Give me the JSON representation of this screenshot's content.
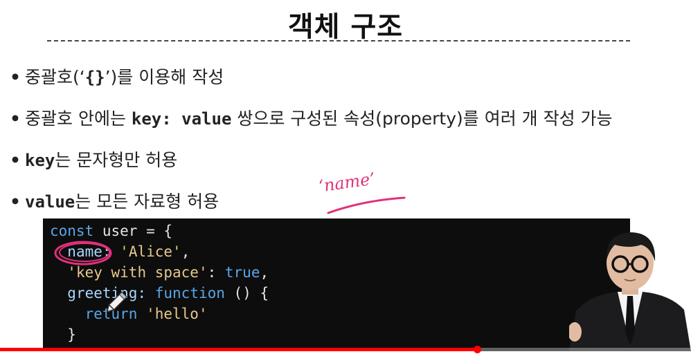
{
  "slide": {
    "title": "객체 구조",
    "bullets": [
      {
        "pre": "중괄호(‘",
        "code": "{}",
        "post": "’)를 이용해 작성"
      },
      {
        "pre": "중괄호 안에는 ",
        "code": "key: value",
        "post": " 쌍으로 구성된 속성(property)를 여러 개 작성 가능"
      },
      {
        "pre": "",
        "code": "key",
        "post": "는 문자형만 허용"
      },
      {
        "pre": "",
        "code": "value",
        "post": "는 모든 자료형 허용"
      }
    ],
    "bullet_symbol": "•",
    "annotation": "‘name’",
    "annotation_color": "#e0317a"
  },
  "code": {
    "l1_kw": "const",
    "l1_rest": " user = {",
    "l2_key": "name:",
    "l2_val": "'Alice'",
    "l2_end": ",",
    "l3_key": "'key with space'",
    "l3_colon": ": ",
    "l3_val": "true",
    "l3_end": ",",
    "l4_key": "greeting:",
    "l4_fn": "function",
    "l4_rest": " () {",
    "l5_kw": "return",
    "l5_val": "'hello'",
    "l6": "}"
  },
  "player": {
    "progress": 0.69,
    "accent": "#ff0000"
  },
  "icons": {
    "cursor": "pencil-cursor-icon",
    "presenter": "presenter-webcam"
  }
}
